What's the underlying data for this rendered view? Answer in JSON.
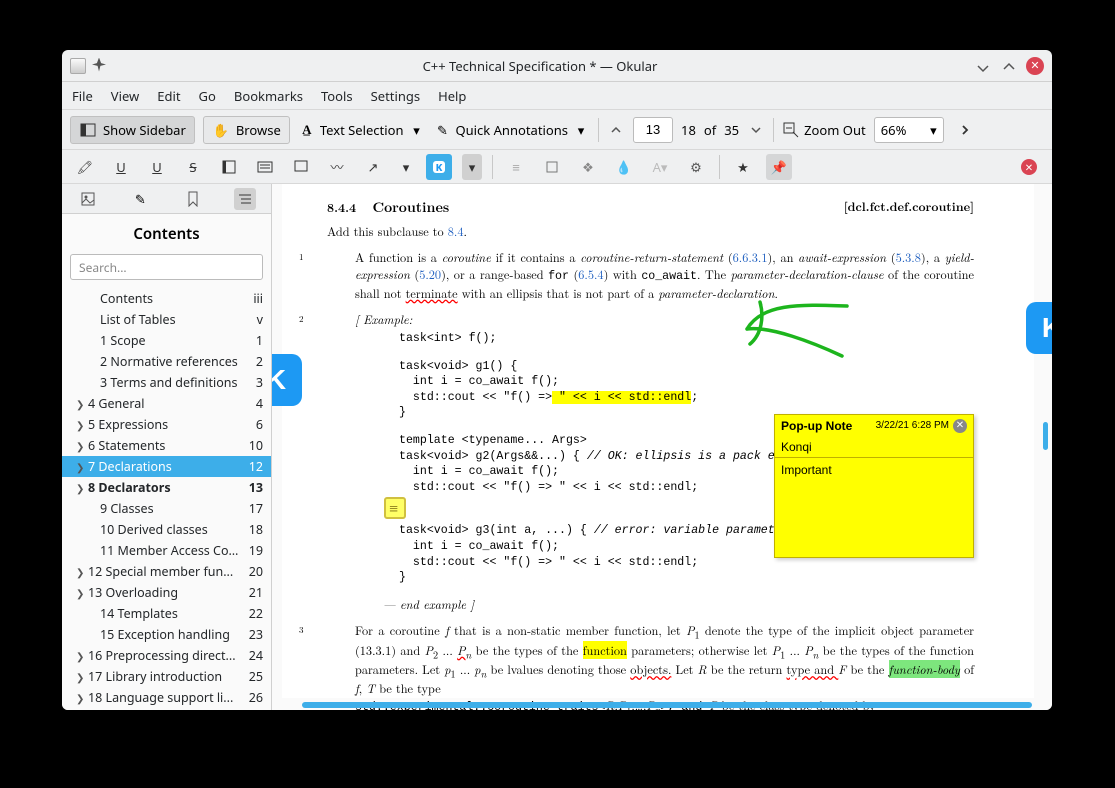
{
  "window": {
    "title": "C++ Technical Specification * — Okular"
  },
  "menu": [
    "File",
    "View",
    "Edit",
    "Go",
    "Bookmarks",
    "Tools",
    "Settings",
    "Help"
  ],
  "toolbar": {
    "show_sidebar": "Show Sidebar",
    "browse": "Browse",
    "text_selection": "Text Selection",
    "quick_annotations": "Quick Annotations",
    "page_current": "13",
    "page_info_a": "18",
    "page_info_of": "of",
    "page_info_b": "35",
    "zoom_out": "Zoom Out",
    "zoom_value": "66%"
  },
  "sidebar": {
    "title": "Contents",
    "search_placeholder": "Search...",
    "items": [
      {
        "label": "Contents",
        "page": "iii",
        "chev": false,
        "lev": 2
      },
      {
        "label": "List of Tables",
        "page": "v",
        "chev": false,
        "lev": 2
      },
      {
        "label": "1 Scope",
        "page": "1",
        "chev": false,
        "lev": 2
      },
      {
        "label": "2 Normative references",
        "page": "2",
        "chev": false,
        "lev": 2
      },
      {
        "label": "3 Terms and definitions",
        "page": "3",
        "chev": false,
        "lev": 2
      },
      {
        "label": "4 General",
        "page": "4",
        "chev": true,
        "lev": 1
      },
      {
        "label": "5 Expressions",
        "page": "6",
        "chev": true,
        "lev": 1
      },
      {
        "label": "6 Statements",
        "page": "10",
        "chev": true,
        "lev": 1
      },
      {
        "label": "7 Declarations",
        "page": "12",
        "chev": true,
        "lev": 1,
        "sel": true
      },
      {
        "label": "8 Declarators",
        "page": "13",
        "chev": true,
        "lev": 1,
        "bold": true
      },
      {
        "label": "9 Classes",
        "page": "17",
        "chev": false,
        "lev": 2
      },
      {
        "label": "10 Derived classes",
        "page": "18",
        "chev": false,
        "lev": 2
      },
      {
        "label": "11 Member Access Con...",
        "page": "19",
        "chev": false,
        "lev": 2
      },
      {
        "label": "12 Special member fun...",
        "page": "20",
        "chev": true,
        "lev": 1
      },
      {
        "label": "13 Overloading",
        "page": "21",
        "chev": true,
        "lev": 1
      },
      {
        "label": "14 Templates",
        "page": "22",
        "chev": false,
        "lev": 2
      },
      {
        "label": "15 Exception handling",
        "page": "23",
        "chev": false,
        "lev": 2
      },
      {
        "label": "16 Preprocessing direct...",
        "page": "24",
        "chev": true,
        "lev": 1
      },
      {
        "label": "17 Library introduction",
        "page": "25",
        "chev": true,
        "lev": 1
      },
      {
        "label": "18 Language support li...",
        "page": "26",
        "chev": true,
        "lev": 1
      }
    ]
  },
  "doc": {
    "sec_num": "8.4.4",
    "sec_title": "Coroutines",
    "sec_ref": "[dcl.fct.def.coroutine]",
    "add_text_a": "Add this subclause to ",
    "add_link": "8.4",
    "add_text_b": ".",
    "p1": {
      "a": "A function is a ",
      "b": "coroutine",
      "c": " if it contains a ",
      "d": "coroutine-return-statement",
      "e": "6.6.3.1",
      "f": ", an ",
      "g": "await-expression",
      "h": "5.3.8",
      "i": ", a ",
      "j": "yield-expression",
      "k": "5.20",
      "l": ", or a range-based ",
      "m": "for",
      "n": "6.5.4",
      "o": " with ",
      "p": "co_await",
      "q": ". The ",
      "r": "parameter-declaration-clause",
      "s": " of the coroutine shall not ",
      "t": "terminate",
      "u": " with an ellipsis that is not part of a ",
      "v": "parameter-declaration",
      "w": "."
    },
    "ex_open": "[ Example:",
    "code1": "task<int> f();",
    "code2": "task<void> g1() {\n  int i = co_await f();\n  std::cout << \"f() => \" << i << std::endl;\n}",
    "code2_hl": " \" << i << std::endl",
    "code3": "template <typename... Args>\ntask<void> g2(Args&&...) { // OK: ellipsis is a pack expansion\n  int i = co_await f();\n  std::cout << \"f() => \" << i << std::endl;\n}",
    "code4": "task<void> g3(int a, ...) { // error: variable parameter list not allowed\n  int i = co_await f();\n  std::cout << \"f() => \" << i << std::endl;\n}",
    "ex_close": "— end example ]",
    "p3": {
      "a": "For a coroutine ",
      "b": " that is a non-static member function, let ",
      "c": " denote the type of the implicit object parameter (13.3.1) and ",
      "d": " be the types of the ",
      "e": "function",
      "f": " parameters; otherwise let ",
      "g": " be the types of the function parameters.   Let ",
      "h": " be lvalues denoting those ",
      "i": "objects.",
      "j": "   Let ",
      "k": " be the return ",
      "l": "type and ",
      "m": " be the ",
      "n": "function-body",
      "o": " of ",
      "p": " be the type ",
      "q": "std::experimental::coroutine_traits<",
      "r": ">, and ",
      "s": " be the class type denoted by"
    }
  },
  "popup": {
    "title": "Pop-up Note",
    "time": "3/22/21 6:28 PM",
    "author": "Konqi",
    "body": "Important"
  }
}
